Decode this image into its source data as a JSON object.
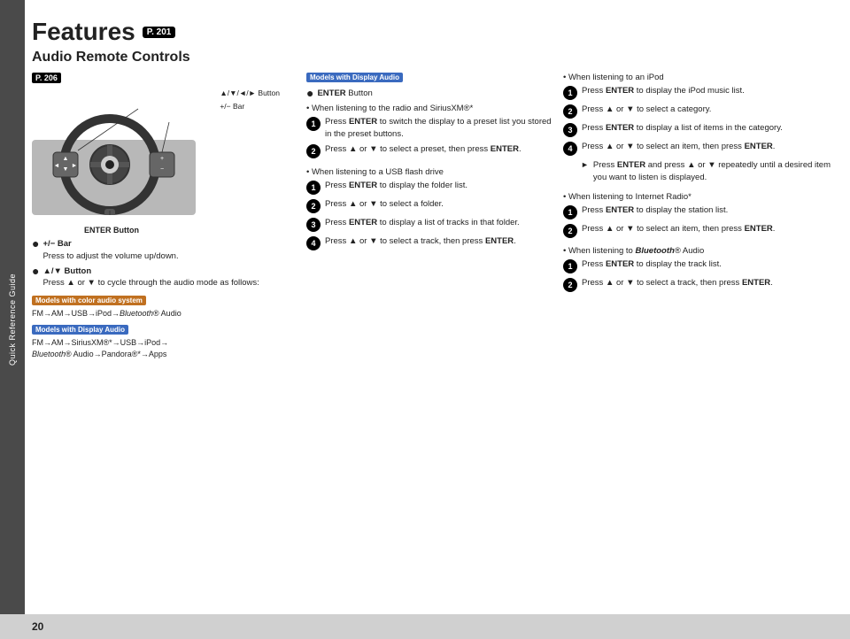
{
  "sidebar": {
    "label": "Quick Reference Guide"
  },
  "page": {
    "number": "20",
    "title": "Features",
    "title_ref": "P. 201",
    "section_title": "Audio Remote Controls",
    "section_ref": "P. 206"
  },
  "badges": {
    "color_audio": "Models with color audio system",
    "display_audio": "Models with Display Audio"
  },
  "left_col": {
    "diagram_labels": {
      "button_label": "▲/▼/◄/► Button",
      "bar_label": "+/− Bar"
    },
    "enter_button_label": "ENTER Button",
    "bullets": [
      {
        "icon": "+/−",
        "text": "Bar",
        "sub": "Press to adjust the volume up/down."
      },
      {
        "icon": "▲/▼",
        "text": "Button",
        "sub": "Press ▲ or ▼ to cycle through the audio mode as follows:"
      }
    ],
    "flow_color": "FM→AM→USB→iPod→Bluetooth® Audio",
    "flow_display": "FM→AM→SiriusXM®*→USB→iPod→Bluetooth® Audio→Pandora®*→Apps"
  },
  "middle_col": {
    "display_audio_label": "Models with Display Audio",
    "enter_button_label": "ENTER Button",
    "when_radio": "When listening to the radio and SiriusXM®*",
    "steps_radio": [
      {
        "num": "1",
        "text": "Press ENTER to switch the display to a preset list you stored in the preset buttons."
      },
      {
        "num": "2",
        "text": "Press ▲ or ▼ to select a preset, then press ENTER."
      }
    ],
    "when_usb": "When listening to a USB flash drive",
    "steps_usb": [
      {
        "num": "1",
        "text": "Press ENTER to display the folder list."
      },
      {
        "num": "2",
        "text": "Press ▲ or ▼ to select a folder."
      },
      {
        "num": "3",
        "text": "Press ENTER to display a list of tracks in that folder."
      },
      {
        "num": "4",
        "text": "Press ▲ or ▼ to select a track, then press ENTER."
      }
    ]
  },
  "right_col": {
    "when_ipod": "When listening to an iPod",
    "steps_ipod": [
      {
        "num": "1",
        "text": "Press ENTER to display the iPod music list."
      },
      {
        "num": "2",
        "text": "Press ▲ or ▼ to select a category."
      },
      {
        "num": "3",
        "text": "Press ENTER to display a list of items in the category."
      },
      {
        "num": "4",
        "text": "Press ▲ or ▼ to select an item, then press ENTER."
      }
    ],
    "arrow_step": "Press ENTER and press ▲ or ▼ repeatedly until a desired item you want to listen is displayed.",
    "when_internet": "When listening to Internet Radio*",
    "steps_internet": [
      {
        "num": "1",
        "text": "Press ENTER to display the station list."
      },
      {
        "num": "2",
        "text": "Press ▲ or ▼ to select an item, then press ENTER."
      }
    ],
    "when_bluetooth": "When listening to Bluetooth® Audio",
    "steps_bluetooth": [
      {
        "num": "1",
        "text": "Press ENTER to display the track list."
      },
      {
        "num": "2",
        "text": "Press ▲ or ▼ to select a track, then press ENTER."
      }
    ]
  }
}
